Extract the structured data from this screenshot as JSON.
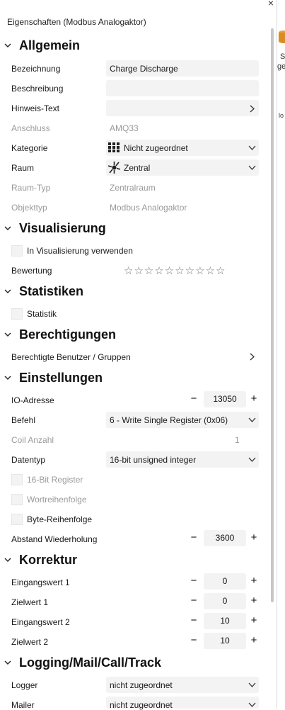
{
  "panel": {
    "title": "Eigenschaften (Modbus Analogaktor)",
    "close_glyph": "×"
  },
  "right_pane": {
    "text1": "S",
    "text2": "ge",
    "text3": "lo"
  },
  "sections": {
    "allgemein": "Allgemein",
    "visualisierung": "Visualisierung",
    "statistiken": "Statistiken",
    "berechtigungen": "Berechtigungen",
    "einstellungen": "Einstellungen",
    "korrektur": "Korrektur",
    "logging": "Logging/Mail/Call/Track"
  },
  "allgemein": {
    "bezeichnung_label": "Bezeichnung",
    "bezeichnung_value": "Charge Discharge",
    "beschreibung_label": "Beschreibung",
    "beschreibung_value": "",
    "hinweis_label": "Hinweis-Text",
    "anschluss_label": "Anschluss",
    "anschluss_value": "AMQ33",
    "kategorie_label": "Kategorie",
    "kategorie_value": "Nicht zugeordnet",
    "raum_label": "Raum",
    "raum_value": "Zentral",
    "raumtyp_label": "Raum-Typ",
    "raumtyp_value": "Zentralraum",
    "objekttyp_label": "Objekttyp",
    "objekttyp_value": "Modbus Analogaktor"
  },
  "visualisierung": {
    "in_vis_label": "In Visualisierung verwenden",
    "bewertung_label": "Bewertung",
    "stars": "☆☆☆☆☆☆☆☆☆☆",
    "rating": 0
  },
  "statistiken": {
    "statistik_label": "Statistik"
  },
  "berechtigungen": {
    "benutzer_label": "Berechtigte Benutzer / Gruppen"
  },
  "einstellungen": {
    "io_label": "IO-Adresse",
    "io_value": "13050",
    "befehl_label": "Befehl",
    "befehl_value": "6 - Write Single Register (0x06)",
    "coil_label": "Coil Anzahl",
    "coil_value": "1",
    "datentyp_label": "Datentyp",
    "datentyp_value": "16-bit unsigned integer",
    "reg16_label": "16-Bit Register",
    "wort_label": "Wortreihenfolge",
    "byte_label": "Byte-Reihenfolge",
    "abstand_label": "Abstand Wiederholung",
    "abstand_value": "3600"
  },
  "korrektur": {
    "ein1_label": "Eingangswert 1",
    "ein1_value": "0",
    "ziel1_label": "Zielwert 1",
    "ziel1_value": "0",
    "ein2_label": "Eingangswert 2",
    "ein2_value": "10",
    "ziel2_label": "Zielwert 2",
    "ziel2_value": "10"
  },
  "logging": {
    "logger_label": "Logger",
    "logger_value": "nicht zugeordnet",
    "mailer_label": "Mailer",
    "mailer_value": "nicht zugeordnet"
  },
  "stepper": {
    "minus": "−",
    "plus": "+"
  },
  "colors": {
    "field_bg": "#f3f3f3",
    "disabled_text": "#9a9a9a",
    "scrollbar": "#c7c7c7"
  }
}
